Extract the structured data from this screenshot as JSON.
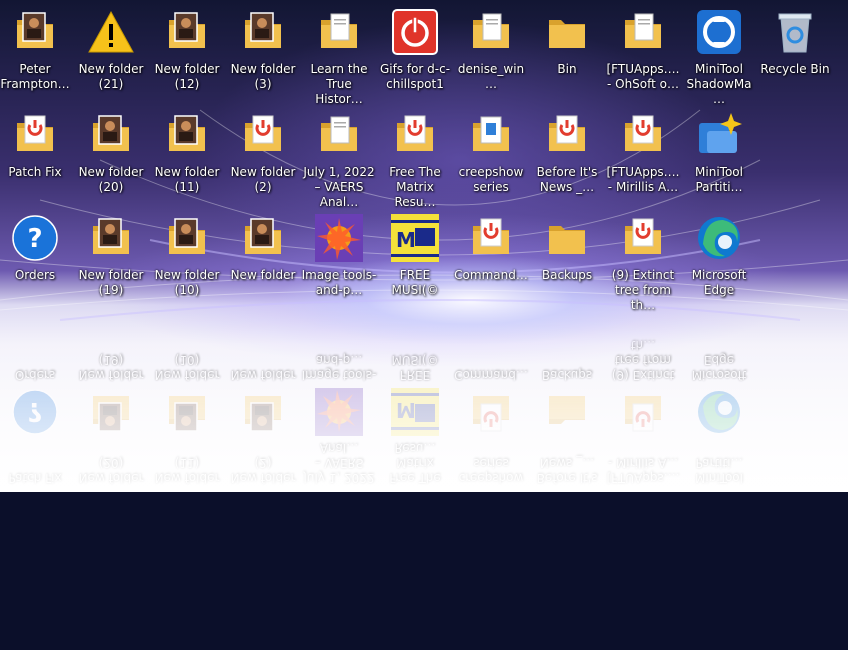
{
  "desktop": {
    "icons": [
      {
        "label": "Peter Frampton…",
        "type": "folder-photo"
      },
      {
        "label": "New folder (21)",
        "type": "warning"
      },
      {
        "label": "New folder (12)",
        "type": "folder-photo"
      },
      {
        "label": "New folder (3)",
        "type": "folder-photo"
      },
      {
        "label": "Learn the True Histor…",
        "type": "folder-doc"
      },
      {
        "label": "Gifs for d-c-chillspot1",
        "type": "power-button"
      },
      {
        "label": "denise_win…",
        "type": "folder-doc"
      },
      {
        "label": "Bin",
        "type": "folder"
      },
      {
        "label": "[FTUApps…. - OhSoft o…",
        "type": "folder-doc"
      },
      {
        "label": "MiniTool ShadowMa…",
        "type": "minitool-shadowmaker"
      },
      {
        "label": "Recycle Bin",
        "type": "recycle-bin"
      },
      {
        "label": "Patch Fix",
        "type": "folder-pdf"
      },
      {
        "label": "New folder (20)",
        "type": "folder-photo"
      },
      {
        "label": "New folder (11)",
        "type": "folder-photo"
      },
      {
        "label": "New folder (2)",
        "type": "folder-pdf"
      },
      {
        "label": "July 1, 2022 – VAERS Anal…",
        "type": "folder-doc"
      },
      {
        "label": "Free The Matrix Resu…",
        "type": "folder-pdf"
      },
      {
        "label": "creepshow series",
        "type": "folder-blue"
      },
      {
        "label": "Before It's News _…",
        "type": "folder-pdf"
      },
      {
        "label": "[FTUApps…. - Mirillis A…",
        "type": "folder-pdf"
      },
      {
        "label": "MiniTool Partiti…",
        "type": "minitool-partition"
      },
      {
        "label": "Orders",
        "type": "help"
      },
      {
        "label": "New folder (19)",
        "type": "folder-photo"
      },
      {
        "label": "New folder (10)",
        "type": "folder-photo"
      },
      {
        "label": "New folder",
        "type": "folder-photo"
      },
      {
        "label": "Image tools-and-p…",
        "type": "image-tools"
      },
      {
        "label": "FREE MUSI(©",
        "type": "free-music"
      },
      {
        "label": "Command…",
        "type": "folder-pdf"
      },
      {
        "label": "Backups",
        "type": "folder"
      },
      {
        "label": "(9) Extinct tree from th…",
        "type": "folder-pdf"
      },
      {
        "label": "Microsoft Edge",
        "type": "edge"
      }
    ]
  },
  "colors": {
    "folder": "#f2c14e",
    "folder_dark": "#d9a22d",
    "pdf_red": "#e23d2f",
    "power_red": "#e0342a",
    "help_blue": "#1a73d9",
    "edge_blue": "#0f79d0",
    "edge_green": "#3dbb7a"
  }
}
